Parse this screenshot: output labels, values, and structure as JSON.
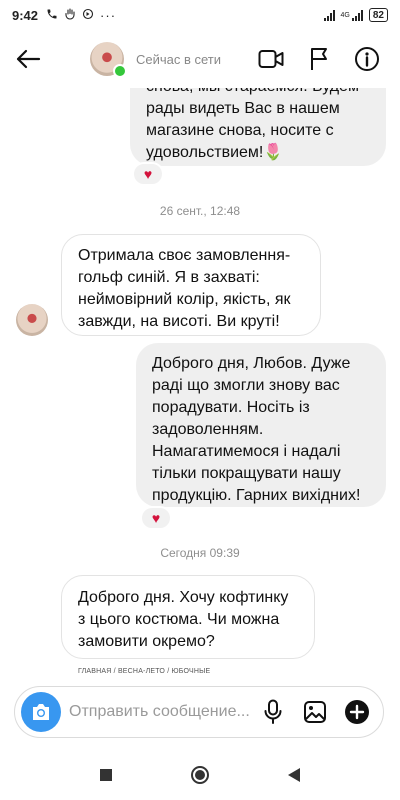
{
  "status_bar": {
    "time": "9:42",
    "network": "4G",
    "battery": "82"
  },
  "header": {
    "status": "Сейчас в сети"
  },
  "messages": [
    {
      "id": "m1",
      "direction": "out",
      "text": "снова, мы стараемся. Будем рады видеть Вас в нашем магазине снова, носите с удовольствием!🌷",
      "reaction": "♥"
    },
    {
      "id": "t1",
      "timestamp": "26 сент., 12:48"
    },
    {
      "id": "m2",
      "direction": "in",
      "text": "Отримала своє замовлення-гольф синій. Я в захваті: неймовірний колір, якість, як завжди, на висоті. Ви круті!"
    },
    {
      "id": "m3",
      "direction": "out",
      "text": "Доброго дня, Любов. Дуже раді що змогли знову вас порадувати. Носіть із задоволенням. Намагатимемося і надалі тільки покращувати нашу продукцію. Гарних вихідних!",
      "reaction": "♥"
    },
    {
      "id": "t2",
      "timestamp": "Сегодня 09:39"
    },
    {
      "id": "m4",
      "direction": "in",
      "text": "Доброго дня. Хочу кофтинку з цього костюма. Чи можна замовити окремо?"
    }
  ],
  "breadcrumb": "ГЛАВНАЯ / ВЕСНА-ЛЕТО / ЮБОЧНЫЕ",
  "composer": {
    "placeholder": "Отправить сообщение..."
  },
  "colors": {
    "accent": "#3897f0",
    "online": "#34c73b",
    "heart": "#d3123c",
    "bubble_out": "#efefef"
  }
}
